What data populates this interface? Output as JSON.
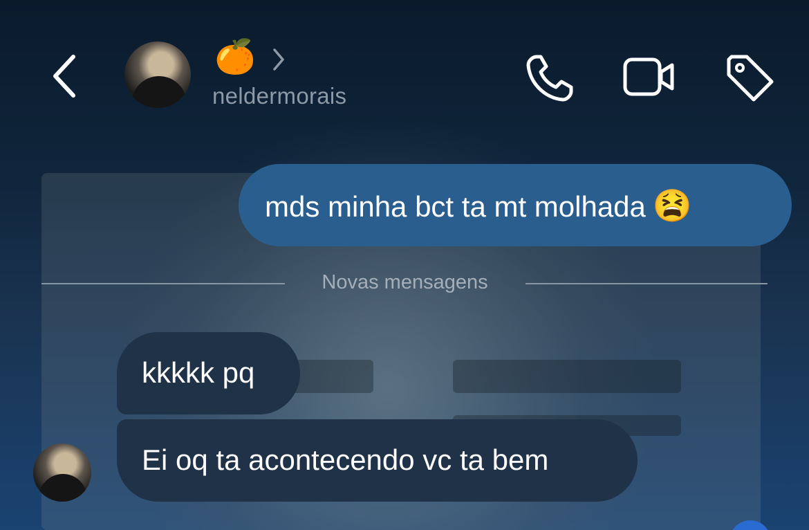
{
  "header": {
    "name_emoji": "🍊",
    "username": "neldermorais",
    "icons": [
      "back-icon",
      "chevron-right-icon",
      "phone-icon",
      "video-icon",
      "tag-icon"
    ]
  },
  "messages": {
    "sent": [
      {
        "text": "mds minha bct ta mt molhada",
        "emoji": "😫"
      }
    ],
    "divider_label": "Novas mensagens",
    "received": [
      {
        "text": "kkkkk pq"
      },
      {
        "text": "Ei oq ta acontecendo vc ta bem"
      }
    ]
  },
  "colors": {
    "background": "#0b1a2c",
    "sent_bubble": "#2a5e8f",
    "received_bubble": "#1f3248",
    "muted_text": "#8e99a6"
  }
}
